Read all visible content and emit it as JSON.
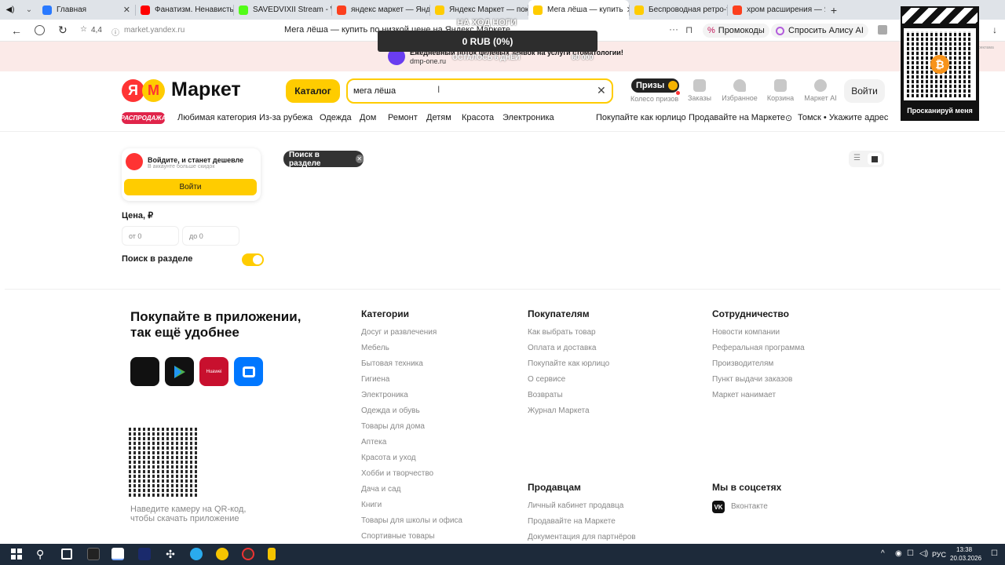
{
  "browser": {
    "tabs": [
      {
        "label": "Главная",
        "color": "#2979ff"
      },
      {
        "label": "Фанатизм. Ненависть в",
        "color": "#ff0000"
      },
      {
        "label": "SAVEDVIXII Stream - Wat",
        "color": "#53fc18"
      },
      {
        "label": "яндекс маркет — Яндекс",
        "color": "#fc3f1d"
      },
      {
        "label": "Яндекс Маркет — покуп",
        "color": "#fc0"
      },
      {
        "label": "Мега лёша — купить",
        "color": "#fc0"
      },
      {
        "label": "Беспроводная ретро-те",
        "color": "#fc0"
      },
      {
        "label": "хром расширения — Янд",
        "color": "#fc3f1d"
      }
    ],
    "rating": "4,4",
    "url": "market.yandex.ru",
    "page_title": "Мега лёша — купить по низкой цене на Яндекс Маркете",
    "promo_label": "Промокоды",
    "alice_label": "Спросить Алису AI"
  },
  "overlay": {
    "heading": "НА ХОД НОГИ",
    "amount": "0 RUB (0%)",
    "remaining": "ОСТАЛОСЬ 6 ДНЕЙ",
    "goal": "60 000"
  },
  "banner": {
    "text": "Ежедневный поток целевых заявок на услуги стоматологии!",
    "link": "dmp-one.ru",
    "badge": "реклама"
  },
  "qr_overlay": {
    "label": "Просканируй меня"
  },
  "header": {
    "logo_text": "Маркет",
    "catalog_button": "Каталог",
    "search_value": "мега лёша",
    "prizes_label": "Призы",
    "prizes_caption": "Колесо призов",
    "icons": [
      {
        "label": "Заказы",
        "icon": "box-icon"
      },
      {
        "label": "Избранное",
        "icon": "heart-icon"
      },
      {
        "label": "Корзина",
        "icon": "cart-icon"
      },
      {
        "label": "Маркет AI",
        "icon": "ai-icon"
      }
    ],
    "login_button": "Войти"
  },
  "nav": {
    "sale": "РАСПРОДАЖА",
    "items": [
      "Любимая категория",
      "Из-за рубежа",
      "Одежда",
      "Дом",
      "Ремонт",
      "Детям",
      "Красота",
      "Электроника"
    ],
    "right": [
      "Покупайте как юрлицо",
      "Продавайте на Маркете"
    ],
    "location": "Томск • Укажите адрес"
  },
  "sidebar": {
    "login_title": "Войдите, и станет дешевле",
    "login_sub": "В аккаунте больше скидок",
    "login_button": "Войти",
    "price_title": "Цена, ₽",
    "price_from": "от 0",
    "price_to": "до 0",
    "section_search": "Поиск в разделе"
  },
  "main": {
    "chip": "Поиск в разделе"
  },
  "footer": {
    "app_title": "Покупайте в приложении,\nтак ещё удобнее",
    "qr_caption": "Наведите камеру на QR-код,\nчтобы скачать приложение",
    "categories": {
      "title": "Категории",
      "links": [
        "Досуг и развлечения",
        "Мебель",
        "Бытовая техника",
        "Гигиена",
        "Электроника",
        "Одежда и обувь",
        "Товары для дома",
        "Аптека",
        "Красота и уход",
        "Хобби и творчество",
        "Дача и сад",
        "Книги",
        "Товары для школы и офиса",
        "Спортивные товары"
      ]
    },
    "buyers": {
      "title": "Покупателям",
      "links": [
        "Как выбрать товар",
        "Оплата и доставка",
        "Покупайте как юрлицо",
        "О сервисе",
        "Возвраты",
        "Журнал Маркета"
      ]
    },
    "partners": {
      "title": "Сотрудничество",
      "links": [
        "Новости компании",
        "Реферальная программа",
        "Производителям",
        "Пункт выдачи заказов",
        "Маркет нанимает"
      ]
    },
    "sellers": {
      "title": "Продавцам",
      "links": [
        "Личный кабинет продавца",
        "Продавайте на Маркете",
        "Документация для партнёров"
      ]
    },
    "social": {
      "title": "Мы в соцсетях",
      "vk": "Вконтакте"
    },
    "store_badges": [
      "Huawei"
    ]
  },
  "taskbar": {
    "lang": "РУС",
    "time": "13:38",
    "date": "20.03.2026"
  }
}
